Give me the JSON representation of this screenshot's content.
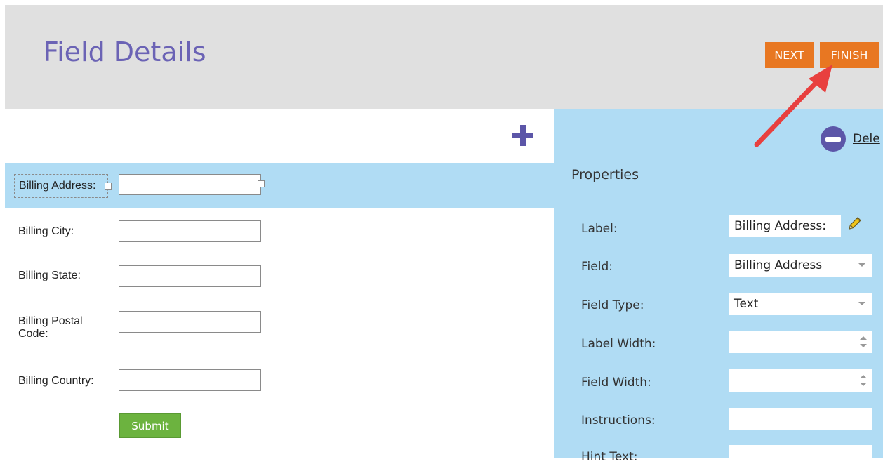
{
  "header": {
    "title": "Field Details",
    "next_label": "NEXT",
    "finish_label": "FINISH"
  },
  "form": {
    "fields": [
      {
        "label": "Billing Address:",
        "value": ""
      },
      {
        "label": "Billing City:",
        "value": ""
      },
      {
        "label": "Billing State:",
        "value": ""
      },
      {
        "label": "Billing Postal Code:",
        "value": ""
      },
      {
        "label": "Billing Country:",
        "value": ""
      }
    ],
    "submit_label": "Submit"
  },
  "panel": {
    "delete_label": "Dele",
    "heading": "Properties",
    "label": {
      "label": "Label:",
      "value": "Billing Address:"
    },
    "field": {
      "label": "Field:",
      "value": "Billing Address"
    },
    "field_type": {
      "label": "Field Type:",
      "value": "Text"
    },
    "label_width": {
      "label": "Label Width:",
      "value": ""
    },
    "field_width": {
      "label": "Field Width:",
      "value": ""
    },
    "instructions": {
      "label": "Instructions:",
      "value": ""
    },
    "hint_text": {
      "label": "Hint Text:",
      "value": ""
    }
  },
  "colors": {
    "header_bg": "#e0e0e0",
    "title": "#6b63b5",
    "action_button": "#e87722",
    "selected_row": "#b0dcf4",
    "submit": "#6cb33f",
    "icon": "#5c56a8",
    "annotation_arrow": "#e8403f"
  },
  "icons": [
    "plus-icon",
    "delete-icon",
    "pencil-icon",
    "chevron-down-icon",
    "spinner-icon"
  ]
}
